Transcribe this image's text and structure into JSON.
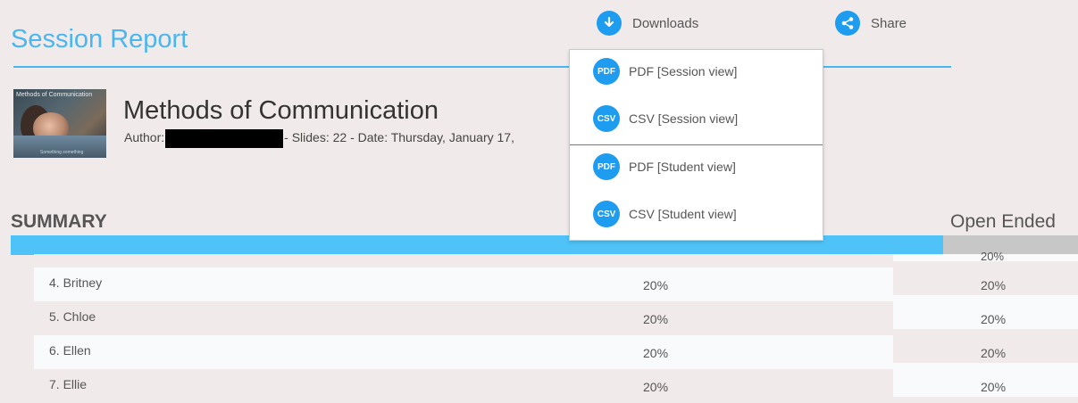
{
  "header": {
    "title": "Session Report",
    "downloads_label": "Downloads",
    "share_label": "Share",
    "downloads_icon": "download-icon",
    "share_icon": "share-icon"
  },
  "downloads_menu": {
    "items": [
      {
        "badge": "PDF",
        "label": "PDF [Session view]"
      },
      {
        "badge": "CSV",
        "label": "CSV [Session view]"
      },
      {
        "badge": "PDF",
        "label": "PDF [Student view]"
      },
      {
        "badge": "CSV",
        "label": "CSV [Student view]"
      }
    ]
  },
  "presentation": {
    "thumbnail_text": "Methods of Communication",
    "thumbnail_footer": "Something something",
    "title": "Methods of Communication",
    "author_label": "Author:",
    "meta_rest": "- Slides: 22 - Date: Thursday, January 17,"
  },
  "summary": {
    "heading": "SUMMARY",
    "open_ended_heading": "Open Ended",
    "rows": [
      {
        "name": "",
        "pct": ""
      },
      {
        "name": "4. Britney",
        "pct": "20%"
      },
      {
        "name": "5. Chloe",
        "pct": "20%"
      },
      {
        "name": "6. Ellen",
        "pct": "20%"
      },
      {
        "name": "7. Ellie",
        "pct": "20%"
      }
    ],
    "open_ended": [
      "20%",
      "20%",
      "20%",
      "20%",
      "20%"
    ]
  },
  "colors": {
    "accent": "#4ab6f0",
    "icon_blue": "#1e9cf0",
    "header_bar": "#4fc3f7"
  }
}
